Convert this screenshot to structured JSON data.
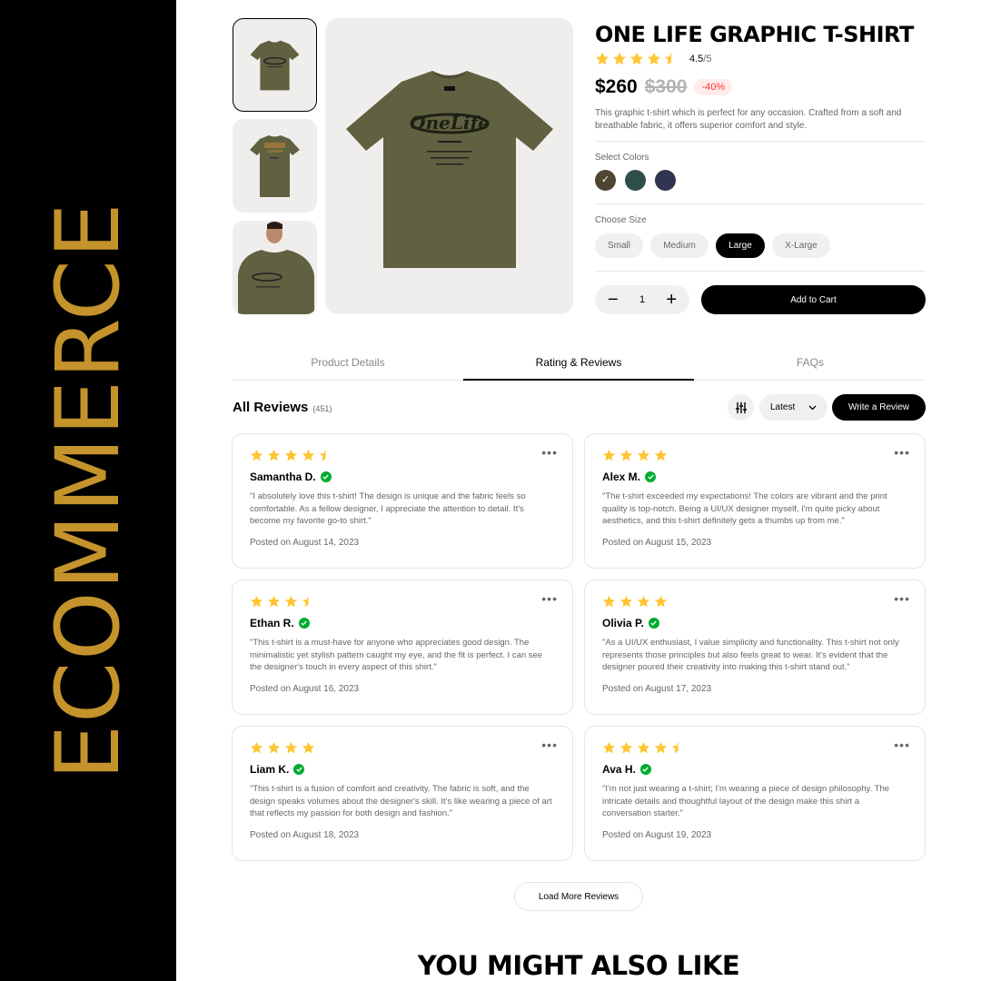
{
  "banner": {
    "text": "ECOMMERCE",
    "color": "#c4932b"
  },
  "product": {
    "title": "ONE LIFE GRAPHIC T-SHIRT",
    "rating": 4.5,
    "rating_value": "4.5",
    "rating_max": "/5",
    "price": "$260",
    "old_price": "$300",
    "discount": "-40%",
    "description": "This graphic t-shirt which is perfect for any occasion. Crafted from a soft and breathable fabric, it offers superior comfort and style.",
    "colors_label": "Select Colors",
    "colors": [
      "#4f4631",
      "#314f4a",
      "#31344f"
    ],
    "selected_color": 0,
    "size_label": "Choose Size",
    "sizes": [
      "Small",
      "Medium",
      "Large",
      "X-Large"
    ],
    "selected_size": "Large",
    "quantity": "1",
    "add_to_cart": "Add to Cart",
    "shirt_color": "#5f6140"
  },
  "tabs": [
    "Product Details",
    "Rating & Reviews",
    "FAQs"
  ],
  "active_tab": "Rating & Reviews",
  "reviews_header": {
    "title": "All Reviews",
    "count": "(451)",
    "sort": "Latest",
    "write": "Write a Review"
  },
  "reviews": [
    {
      "name": "Samantha D.",
      "rating": 4.5,
      "text": "\"I absolutely love this t-shirt! The design is unique and the fabric feels so comfortable. As a fellow designer, I appreciate the attention to detail. It's become my favorite go-to shirt.\"",
      "date": "Posted on August 14, 2023"
    },
    {
      "name": "Alex M.",
      "rating": 4,
      "text": "\"The t-shirt exceeded my expectations! The colors are vibrant and the print quality is top-notch. Being a UI/UX designer myself, I'm quite picky about aesthetics, and this t-shirt definitely gets a thumbs up from me.\"",
      "date": "Posted on August 15, 2023"
    },
    {
      "name": "Ethan R.",
      "rating": 3.5,
      "text": "\"This t-shirt is a must-have for anyone who appreciates good design. The minimalistic yet stylish pattern caught my eye, and the fit is perfect. I can see the designer's touch in every aspect of this shirt.\"",
      "date": "Posted on August 16, 2023"
    },
    {
      "name": "Olivia P.",
      "rating": 4,
      "text": "\"As a UI/UX enthusiast, I value simplicity and functionality. This t-shirt not only represents those principles but also feels great to wear. It's evident that the designer poured their creativity into making this t-shirt stand out.\"",
      "date": "Posted on August 17, 2023"
    },
    {
      "name": "Liam K.",
      "rating": 4,
      "text": "\"This t-shirt is a fusion of comfort and creativity. The fabric is soft, and the design speaks volumes about the designer's skill. It's like wearing a piece of art that reflects my passion for both design and fashion.\"",
      "date": "Posted on August 18, 2023"
    },
    {
      "name": "Ava H.",
      "rating": 4.5,
      "text": "\"I'm not just wearing a t-shirt; I'm wearing a piece of design philosophy. The intricate details and thoughtful layout of the design make this shirt a conversation starter.\"",
      "date": "Posted on August 19, 2023"
    }
  ],
  "load_more": "Load More Reviews",
  "also_like": "YOU MIGHT ALSO LIKE",
  "star_color": "#ffc633",
  "verified_color": "#01ab31"
}
